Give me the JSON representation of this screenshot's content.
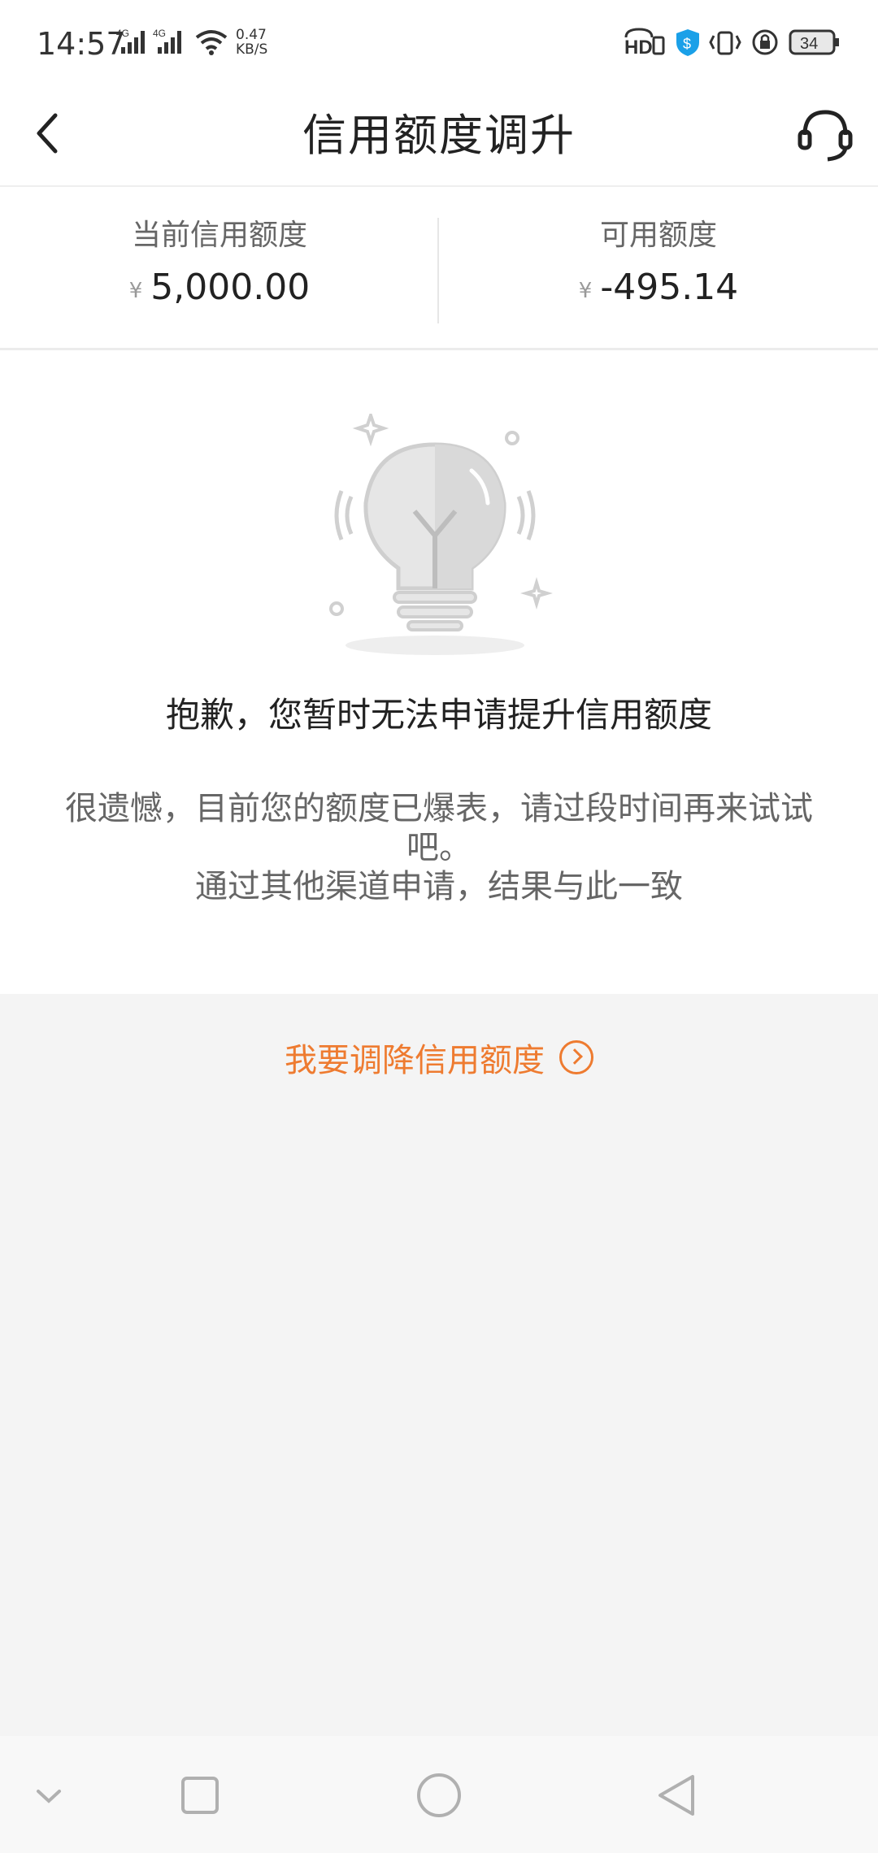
{
  "status_bar": {
    "time": "14:57",
    "net1": "4G",
    "net2": "4G",
    "speed_value": "0.47",
    "speed_unit": "KB/S",
    "hd_label": "HD",
    "battery": "34"
  },
  "header": {
    "title": "信用额度调升"
  },
  "summary": {
    "current_label": "当前信用额度",
    "current_value": "5,000.00",
    "available_label": "可用额度",
    "available_value": "-495.14",
    "currency_symbol": "¥"
  },
  "message": {
    "title": "抱歉，您暂时无法申请提升信用额度",
    "line1": "很遗憾，目前您的额度已爆表，请过段时间再来试试吧。",
    "line2": "通过其他渠道申请，结果与此一致"
  },
  "reduce_link": {
    "label": "我要调降信用额度"
  },
  "colors": {
    "accent": "#ee7b30",
    "background": "#f4f4f4",
    "text_primary": "#222222",
    "text_secondary": "#666666"
  },
  "icons": {
    "back": "chevron-left-icon",
    "service": "headset-icon",
    "illustration": "lightbulb-icon",
    "reduce_arrow": "circle-chevron-right-icon",
    "nav_collapse": "chevron-down-icon",
    "nav_recent": "square-icon",
    "nav_home": "circle-icon",
    "nav_back": "triangle-back-icon"
  }
}
